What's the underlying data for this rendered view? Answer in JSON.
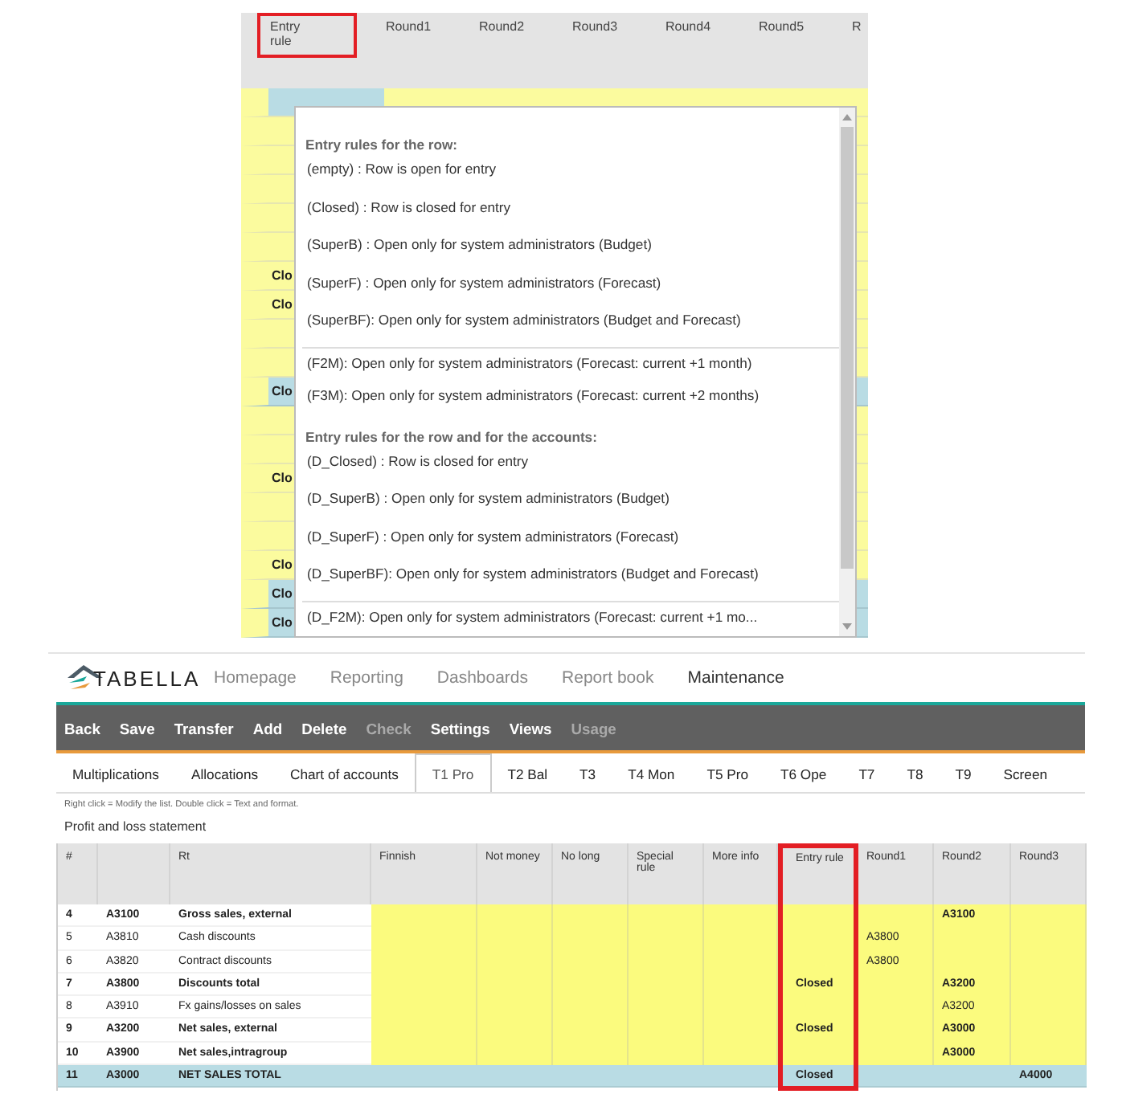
{
  "dropdown_view": {
    "header_columns": [
      {
        "label": "Entry rule",
        "highlighted": true
      },
      {
        "label": "Round1",
        "highlighted": false
      },
      {
        "label": "Round2",
        "highlighted": false
      },
      {
        "label": "Round3",
        "highlighted": false
      },
      {
        "label": "Round4",
        "highlighted": false
      },
      {
        "label": "Round5",
        "highlighted": false
      },
      {
        "label": "R",
        "highlighted": false
      }
    ],
    "grid_rows": [
      {
        "kind": "blue-cell"
      },
      {
        "kind": "yellow"
      },
      {
        "kind": "yellow"
      },
      {
        "kind": "yellow"
      },
      {
        "kind": "yellow"
      },
      {
        "kind": "yellow"
      },
      {
        "kind": "yellow",
        "text": "Clo"
      },
      {
        "kind": "yellow",
        "text": "Clo"
      },
      {
        "kind": "yellow"
      },
      {
        "kind": "yellow"
      },
      {
        "kind": "blue",
        "text": "Clo"
      },
      {
        "kind": "yellow"
      },
      {
        "kind": "yellow"
      },
      {
        "kind": "yellow",
        "text": "Clo"
      },
      {
        "kind": "yellow"
      },
      {
        "kind": "yellow"
      },
      {
        "kind": "yellow",
        "text": "Clo"
      },
      {
        "kind": "blue",
        "text": "Clo"
      },
      {
        "kind": "blue",
        "text": "Clo"
      }
    ],
    "popup": {
      "items": [
        {
          "kind": "heading",
          "text": "Entry rules for the row:"
        },
        {
          "kind": "option",
          "text": "(empty) : Row is open for entry",
          "divider_above": false
        },
        {
          "kind": "option",
          "text": "(Closed) : Row is closed for entry",
          "divider_above": false
        },
        {
          "kind": "option",
          "text": "(SuperB) : Open only for system administrators (Budget)",
          "divider_above": false
        },
        {
          "kind": "option",
          "text": "(SuperF) : Open only for system administrators (Forecast)",
          "divider_above": false
        },
        {
          "kind": "option",
          "text": "(SuperBF): Open only for system administrators (Budget and Forecast)",
          "divider_above": false
        },
        {
          "kind": "option",
          "text": "(F2M): Open only for system administrators (Forecast: current +1 month)",
          "divider_above": true
        },
        {
          "kind": "option",
          "text": "(F3M): Open only for system administrators (Forecast: current +2 months)",
          "divider_above": false
        },
        {
          "kind": "heading",
          "text": "Entry rules for the row and for the accounts:"
        },
        {
          "kind": "option",
          "text": "(D_Closed) : Row is closed for entry",
          "divider_above": false
        },
        {
          "kind": "option",
          "text": "(D_SuperB) : Open only for system administrators (Budget)",
          "divider_above": false
        },
        {
          "kind": "option",
          "text": "(D_SuperF) : Open only for system administrators (Forecast)",
          "divider_above": false
        },
        {
          "kind": "option",
          "text": "(D_SuperBF): Open only for system administrators (Budget and Forecast)",
          "divider_above": false
        },
        {
          "kind": "option",
          "text": "(D_F2M): Open only for system administrators (Forecast: current +1 mo...",
          "divider_above": true
        }
      ]
    }
  },
  "app": {
    "logo": "TABELLA",
    "nav": [
      {
        "label": "Homepage",
        "selected": false
      },
      {
        "label": "Reporting",
        "selected": false
      },
      {
        "label": "Dashboards",
        "selected": false
      },
      {
        "label": "Report book",
        "selected": false
      },
      {
        "label": "Maintenance",
        "selected": true
      }
    ],
    "toolbar": [
      {
        "label": "Back",
        "disabled": false
      },
      {
        "label": "Save",
        "disabled": false
      },
      {
        "label": "Transfer",
        "disabled": false
      },
      {
        "label": "Add",
        "disabled": false
      },
      {
        "label": "Delete",
        "disabled": false
      },
      {
        "label": "Check",
        "disabled": true
      },
      {
        "label": "Settings",
        "disabled": false
      },
      {
        "label": "Views",
        "disabled": false
      },
      {
        "label": "Usage",
        "disabled": true
      }
    ],
    "tabs": [
      {
        "label": "Multiplications",
        "selected": false
      },
      {
        "label": "Allocations",
        "selected": false
      },
      {
        "label": "Chart of accounts",
        "selected": false
      },
      {
        "label": "T1 Pro",
        "selected": true
      },
      {
        "label": "T2 Bal",
        "selected": false
      },
      {
        "label": "T3",
        "selected": false
      },
      {
        "label": "T4 Mon",
        "selected": false
      },
      {
        "label": "T5 Pro",
        "selected": false
      },
      {
        "label": "T6 Ope",
        "selected": false
      },
      {
        "label": "T7",
        "selected": false
      },
      {
        "label": "T8",
        "selected": false
      },
      {
        "label": "T9",
        "selected": false
      },
      {
        "label": "Screen",
        "selected": false
      }
    ],
    "hint": "Right click = Modify the list. Double click = Text and format.",
    "title": "Profit and loss statement",
    "table": {
      "columns": [
        {
          "label": "#",
          "highlighted": false
        },
        {
          "highlighted": false
        },
        {
          "label": "Rt",
          "highlighted": false
        },
        {
          "label": "Finnish",
          "highlighted": false
        },
        {
          "label": "Not money",
          "highlighted": false
        },
        {
          "label": "No long",
          "highlighted": false
        },
        {
          "label": "Special rule",
          "highlighted": false
        },
        {
          "label": "More info",
          "highlighted": false
        },
        {
          "label": "Entry rule",
          "highlighted": true
        },
        {
          "label": "Round1",
          "highlighted": false
        },
        {
          "label": "Round2",
          "highlighted": false
        },
        {
          "label": "Round3",
          "highlighted": false
        }
      ],
      "rows": [
        {
          "cells": [
            "4",
            "A3100",
            "Gross sales, external",
            "",
            "",
            "",
            "",
            "",
            "",
            "",
            "A3100",
            ""
          ],
          "bold": true,
          "total": false
        },
        {
          "cells": [
            "5",
            "A3810",
            "Cash discounts",
            "",
            "",
            "",
            "",
            "",
            "",
            "A3800",
            "",
            ""
          ],
          "bold": false,
          "total": false
        },
        {
          "cells": [
            "6",
            "A3820",
            "Contract discounts",
            "",
            "",
            "",
            "",
            "",
            "",
            "A3800",
            "",
            ""
          ],
          "bold": false,
          "total": false
        },
        {
          "cells": [
            "7",
            "A3800",
            "Discounts total",
            "",
            "",
            "",
            "",
            "",
            "Closed",
            "",
            "A3200",
            ""
          ],
          "bold": true,
          "total": false
        },
        {
          "cells": [
            "8",
            "A3910",
            "Fx gains/losses on sales",
            "",
            "",
            "",
            "",
            "",
            "",
            "",
            "A3200",
            ""
          ],
          "bold": false,
          "total": false
        },
        {
          "cells": [
            "9",
            "A3200",
            "Net sales, external",
            "",
            "",
            "",
            "",
            "",
            "Closed",
            "",
            "A3000",
            ""
          ],
          "bold": true,
          "total": false
        },
        {
          "cells": [
            "10",
            "A3900",
            "Net sales,intragroup",
            "",
            "",
            "",
            "",
            "",
            "",
            "",
            "A3000",
            ""
          ],
          "bold": true,
          "total": false
        },
        {
          "cells": [
            "11",
            "A3000",
            "NET SALES TOTAL",
            "",
            "",
            "",
            "",
            "",
            "Closed",
            "",
            "",
            "A4000"
          ],
          "bold": true,
          "total": true
        }
      ]
    }
  }
}
